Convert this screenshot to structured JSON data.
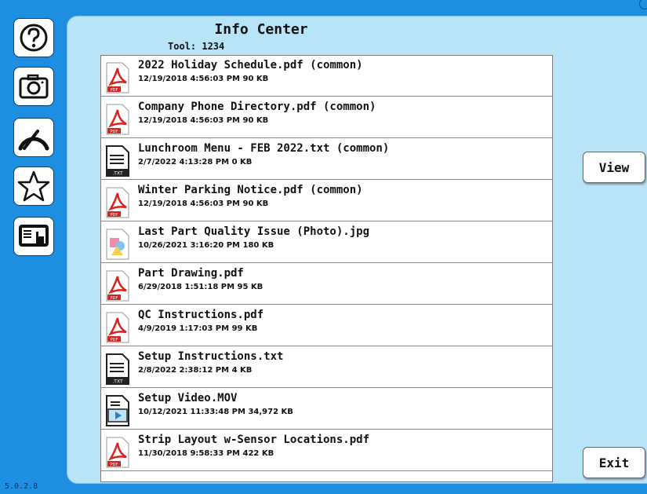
{
  "header": {
    "title": "Info Center",
    "tool_label": "Tool: 1234"
  },
  "version": "5.0.2.8",
  "sidebar": {
    "items": [
      {
        "name": "help",
        "icon": "help-icon"
      },
      {
        "name": "camera",
        "icon": "camera-icon"
      },
      {
        "name": "gauge",
        "icon": "gauge-icon"
      },
      {
        "name": "favorites",
        "icon": "star-icon"
      },
      {
        "name": "touch-screen",
        "icon": "touch-screen-icon"
      }
    ]
  },
  "files": [
    {
      "name": "2022 Holiday Schedule.pdf (common)",
      "meta": "12/19/2018 4:56:03 PM  90 KB",
      "type": "pdf"
    },
    {
      "name": "Company Phone Directory.pdf (common)",
      "meta": "12/19/2018 4:56:03 PM  90 KB",
      "type": "pdf"
    },
    {
      "name": "Lunchroom Menu - FEB 2022.txt (common)",
      "meta": "2/7/2022 4:13:28 PM  0 KB",
      "type": "txt"
    },
    {
      "name": "Winter Parking Notice.pdf (common)",
      "meta": "12/19/2018 4:56:03 PM  90 KB",
      "type": "pdf"
    },
    {
      "name": "Last Part Quality Issue (Photo).jpg",
      "meta": "10/26/2021 3:16:20 PM  180 KB",
      "type": "jpg"
    },
    {
      "name": "Part Drawing.pdf",
      "meta": "6/29/2018 1:51:18 PM  95 KB",
      "type": "pdf"
    },
    {
      "name": "QC Instructions.pdf",
      "meta": "4/9/2019 1:17:03 PM  99 KB",
      "type": "pdf"
    },
    {
      "name": "Setup Instructions.txt",
      "meta": "2/8/2022 2:38:12 PM  4 KB",
      "type": "txt"
    },
    {
      "name": "Setup Video.MOV",
      "meta": "10/12/2021 11:33:48 PM  34,972 KB",
      "type": "mov"
    },
    {
      "name": "Strip Layout w-Sensor Locations.pdf",
      "meta": "11/30/2018 9:58:33 PM  422 KB",
      "type": "pdf"
    }
  ],
  "file_icon_labels": {
    "pdf": "PDF",
    "txt": ".TXT"
  },
  "actions": {
    "view_label": "View",
    "exit_label": "Exit"
  },
  "colors": {
    "background": "#1e8fe0",
    "panel": "#b8e4f7",
    "pdf_red": "#d9231f"
  }
}
